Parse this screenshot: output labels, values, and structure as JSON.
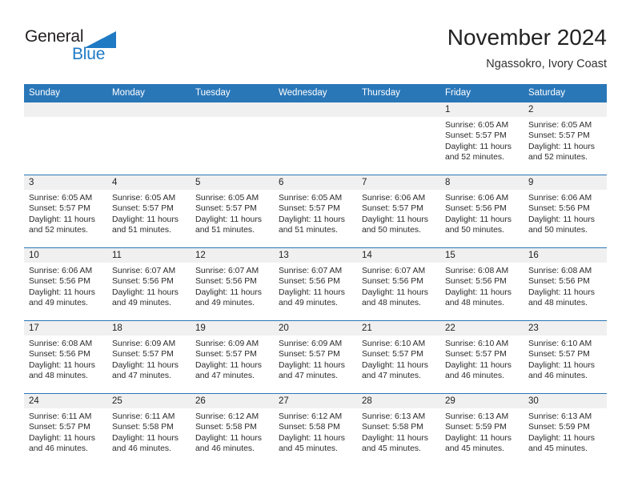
{
  "brand": {
    "name_part1": "General",
    "name_part2": "Blue",
    "triangle_color": "#1f7ac4",
    "text_color": "#231f20"
  },
  "header": {
    "month_title": "November 2024",
    "location": "Ngassokro, Ivory Coast"
  },
  "theme": {
    "header_blue": "#2a77b8",
    "daynum_band": "#f0f0f0",
    "row_divider": "#2a77b8"
  },
  "calendar": {
    "weekday_headers": [
      "Sunday",
      "Monday",
      "Tuesday",
      "Wednesday",
      "Thursday",
      "Friday",
      "Saturday"
    ],
    "weeks": [
      [
        {
          "day": "",
          "empty": true
        },
        {
          "day": "",
          "empty": true
        },
        {
          "day": "",
          "empty": true
        },
        {
          "day": "",
          "empty": true
        },
        {
          "day": "",
          "empty": true
        },
        {
          "day": "1",
          "sunrise": "Sunrise: 6:05 AM",
          "sunset": "Sunset: 5:57 PM",
          "daylight": "Daylight: 11 hours and 52 minutes."
        },
        {
          "day": "2",
          "sunrise": "Sunrise: 6:05 AM",
          "sunset": "Sunset: 5:57 PM",
          "daylight": "Daylight: 11 hours and 52 minutes."
        }
      ],
      [
        {
          "day": "3",
          "sunrise": "Sunrise: 6:05 AM",
          "sunset": "Sunset: 5:57 PM",
          "daylight": "Daylight: 11 hours and 52 minutes."
        },
        {
          "day": "4",
          "sunrise": "Sunrise: 6:05 AM",
          "sunset": "Sunset: 5:57 PM",
          "daylight": "Daylight: 11 hours and 51 minutes."
        },
        {
          "day": "5",
          "sunrise": "Sunrise: 6:05 AM",
          "sunset": "Sunset: 5:57 PM",
          "daylight": "Daylight: 11 hours and 51 minutes."
        },
        {
          "day": "6",
          "sunrise": "Sunrise: 6:05 AM",
          "sunset": "Sunset: 5:57 PM",
          "daylight": "Daylight: 11 hours and 51 minutes."
        },
        {
          "day": "7",
          "sunrise": "Sunrise: 6:06 AM",
          "sunset": "Sunset: 5:57 PM",
          "daylight": "Daylight: 11 hours and 50 minutes."
        },
        {
          "day": "8",
          "sunrise": "Sunrise: 6:06 AM",
          "sunset": "Sunset: 5:56 PM",
          "daylight": "Daylight: 11 hours and 50 minutes."
        },
        {
          "day": "9",
          "sunrise": "Sunrise: 6:06 AM",
          "sunset": "Sunset: 5:56 PM",
          "daylight": "Daylight: 11 hours and 50 minutes."
        }
      ],
      [
        {
          "day": "10",
          "sunrise": "Sunrise: 6:06 AM",
          "sunset": "Sunset: 5:56 PM",
          "daylight": "Daylight: 11 hours and 49 minutes."
        },
        {
          "day": "11",
          "sunrise": "Sunrise: 6:07 AM",
          "sunset": "Sunset: 5:56 PM",
          "daylight": "Daylight: 11 hours and 49 minutes."
        },
        {
          "day": "12",
          "sunrise": "Sunrise: 6:07 AM",
          "sunset": "Sunset: 5:56 PM",
          "daylight": "Daylight: 11 hours and 49 minutes."
        },
        {
          "day": "13",
          "sunrise": "Sunrise: 6:07 AM",
          "sunset": "Sunset: 5:56 PM",
          "daylight": "Daylight: 11 hours and 49 minutes."
        },
        {
          "day": "14",
          "sunrise": "Sunrise: 6:07 AM",
          "sunset": "Sunset: 5:56 PM",
          "daylight": "Daylight: 11 hours and 48 minutes."
        },
        {
          "day": "15",
          "sunrise": "Sunrise: 6:08 AM",
          "sunset": "Sunset: 5:56 PM",
          "daylight": "Daylight: 11 hours and 48 minutes."
        },
        {
          "day": "16",
          "sunrise": "Sunrise: 6:08 AM",
          "sunset": "Sunset: 5:56 PM",
          "daylight": "Daylight: 11 hours and 48 minutes."
        }
      ],
      [
        {
          "day": "17",
          "sunrise": "Sunrise: 6:08 AM",
          "sunset": "Sunset: 5:56 PM",
          "daylight": "Daylight: 11 hours and 48 minutes."
        },
        {
          "day": "18",
          "sunrise": "Sunrise: 6:09 AM",
          "sunset": "Sunset: 5:57 PM",
          "daylight": "Daylight: 11 hours and 47 minutes."
        },
        {
          "day": "19",
          "sunrise": "Sunrise: 6:09 AM",
          "sunset": "Sunset: 5:57 PM",
          "daylight": "Daylight: 11 hours and 47 minutes."
        },
        {
          "day": "20",
          "sunrise": "Sunrise: 6:09 AM",
          "sunset": "Sunset: 5:57 PM",
          "daylight": "Daylight: 11 hours and 47 minutes."
        },
        {
          "day": "21",
          "sunrise": "Sunrise: 6:10 AM",
          "sunset": "Sunset: 5:57 PM",
          "daylight": "Daylight: 11 hours and 47 minutes."
        },
        {
          "day": "22",
          "sunrise": "Sunrise: 6:10 AM",
          "sunset": "Sunset: 5:57 PM",
          "daylight": "Daylight: 11 hours and 46 minutes."
        },
        {
          "day": "23",
          "sunrise": "Sunrise: 6:10 AM",
          "sunset": "Sunset: 5:57 PM",
          "daylight": "Daylight: 11 hours and 46 minutes."
        }
      ],
      [
        {
          "day": "24",
          "sunrise": "Sunrise: 6:11 AM",
          "sunset": "Sunset: 5:57 PM",
          "daylight": "Daylight: 11 hours and 46 minutes."
        },
        {
          "day": "25",
          "sunrise": "Sunrise: 6:11 AM",
          "sunset": "Sunset: 5:58 PM",
          "daylight": "Daylight: 11 hours and 46 minutes."
        },
        {
          "day": "26",
          "sunrise": "Sunrise: 6:12 AM",
          "sunset": "Sunset: 5:58 PM",
          "daylight": "Daylight: 11 hours and 46 minutes."
        },
        {
          "day": "27",
          "sunrise": "Sunrise: 6:12 AM",
          "sunset": "Sunset: 5:58 PM",
          "daylight": "Daylight: 11 hours and 45 minutes."
        },
        {
          "day": "28",
          "sunrise": "Sunrise: 6:13 AM",
          "sunset": "Sunset: 5:58 PM",
          "daylight": "Daylight: 11 hours and 45 minutes."
        },
        {
          "day": "29",
          "sunrise": "Sunrise: 6:13 AM",
          "sunset": "Sunset: 5:59 PM",
          "daylight": "Daylight: 11 hours and 45 minutes."
        },
        {
          "day": "30",
          "sunrise": "Sunrise: 6:13 AM",
          "sunset": "Sunset: 5:59 PM",
          "daylight": "Daylight: 11 hours and 45 minutes."
        }
      ]
    ]
  }
}
